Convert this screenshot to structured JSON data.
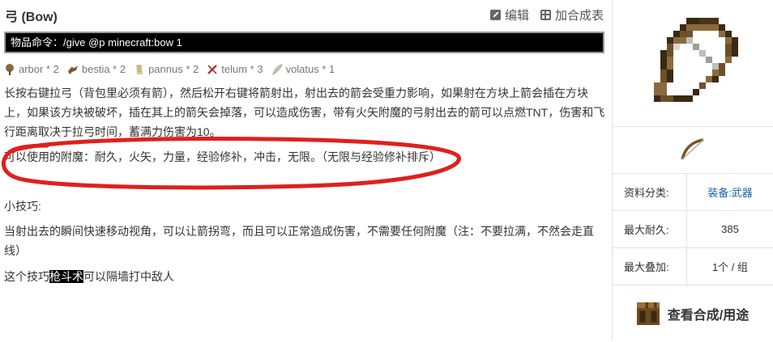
{
  "page": {
    "title": "弓 (Bow)",
    "actions": {
      "edit": "编辑",
      "add_to_table": "加合成表"
    },
    "command": "物品命令：/give @p minecraft:bow 1"
  },
  "materials": [
    {
      "name": "arbor * 2",
      "icon": "arbor-icon"
    },
    {
      "name": "bestia * 2",
      "icon": "bestia-icon"
    },
    {
      "name": "pannus * 2",
      "icon": "pannus-icon"
    },
    {
      "name": "telum * 3",
      "icon": "telum-icon"
    },
    {
      "name": "volatus * 1",
      "icon": "volatus-icon"
    }
  ],
  "content": {
    "desc": "长按右键拉弓（背包里必须有箭），然后松开右键将箭射出，射出去的箭会受重力影响，如果射在方块上箭会插在方块上，如果该方块被破坏，插在其上的箭矢会掉落，可以造成伤害，带有火矢附魔的弓射出去的箭可以点燃TNT，伤害和飞行距离取决于拉弓时间，蓄满力伤害为10。",
    "enchant": "可以使用的附魔：耐久，火矢，力量，经验修补，冲击，无限。（无限与经验修补排斥）",
    "tips_title": "小技巧:",
    "tip1": "当射出去的瞬间快速移动视角，可以让箭拐弯，而且可以正常造成伤害，不需要任何附魔（注：不要拉满，不然会走直线）",
    "tip2_pre": "这个技巧",
    "tip2_hl": "枪斗术",
    "tip2_post": "可以隔墙打中敌人"
  },
  "sidebar": {
    "rows": [
      {
        "key": "资料分类:",
        "value": "装备:武器",
        "link": true
      },
      {
        "key": "最大耐久:",
        "value": "385",
        "link": false
      },
      {
        "key": "最大叠加:",
        "value": "1个 / 组",
        "link": false
      }
    ],
    "recipe_label": "查看合成/用途"
  },
  "colors": {
    "annotation": "#e0201c",
    "link": "#1a5fa8",
    "command_bg": "#000000"
  }
}
